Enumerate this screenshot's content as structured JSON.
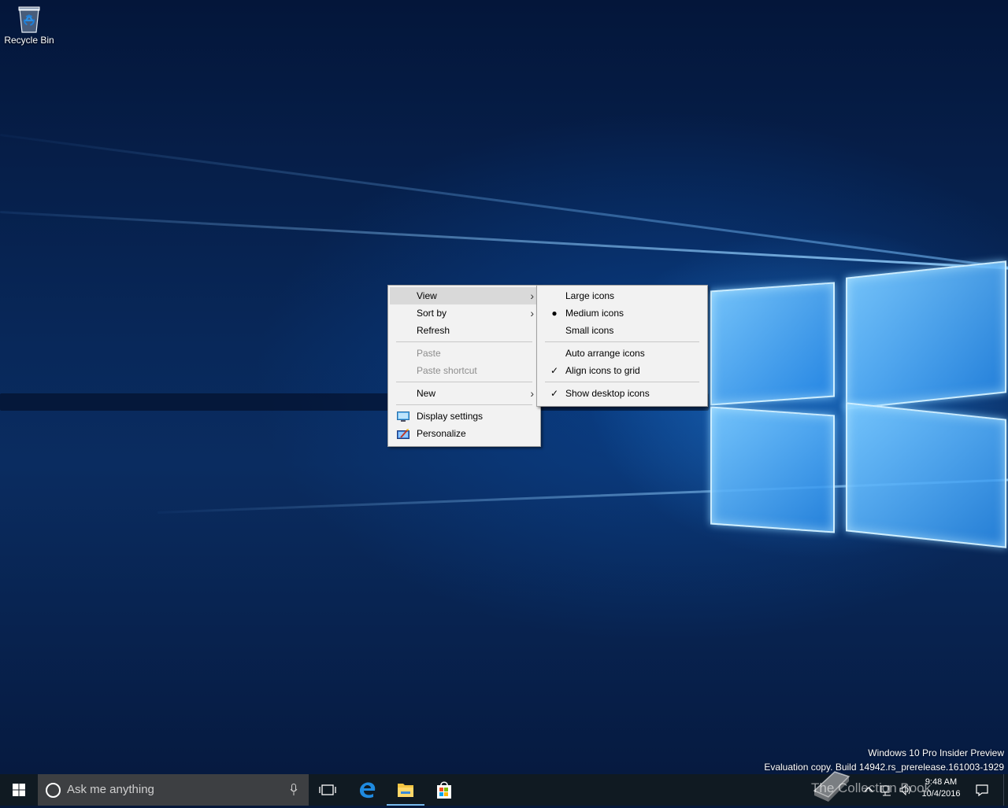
{
  "desktop": {
    "icons": [
      {
        "label": "Recycle Bin"
      }
    ]
  },
  "context_menu": {
    "items": [
      {
        "label": "View",
        "submenu": true,
        "highlighted": true
      },
      {
        "label": "Sort by",
        "submenu": true
      },
      {
        "label": "Refresh"
      },
      {
        "label": "Paste",
        "disabled": true
      },
      {
        "label": "Paste shortcut",
        "disabled": true
      },
      {
        "label": "New",
        "submenu": true
      },
      {
        "label": "Display settings",
        "icon": "display-settings-icon"
      },
      {
        "label": "Personalize",
        "icon": "personalize-icon"
      }
    ]
  },
  "view_submenu": {
    "items": [
      {
        "label": "Large icons"
      },
      {
        "label": "Medium icons",
        "mark": "●"
      },
      {
        "label": "Small icons"
      },
      {
        "label": "Auto arrange icons"
      },
      {
        "label": "Align icons to grid",
        "mark": "✓"
      },
      {
        "label": "Show desktop icons",
        "mark": "✓"
      }
    ]
  },
  "watermark": {
    "line1": "Windows 10 Pro Insider Preview",
    "line2": "Evaluation copy. Build 14942.rs_prerelease.161003-1929"
  },
  "taskbar": {
    "search_placeholder": "Ask me anything",
    "pinned": [
      "task-view-icon",
      "edge-icon",
      "file-explorer-icon",
      "store-icon"
    ],
    "clock_time": "9:48 AM",
    "clock_date": "10/4/2016",
    "overlay_brand": "The Collection Book"
  },
  "colors": {
    "accent": "#0078d7",
    "taskbar": "#101a22",
    "search_box": "#3d3f42",
    "menu_bg": "#f2f2f2",
    "menu_highlight": "#d9d9d9"
  }
}
